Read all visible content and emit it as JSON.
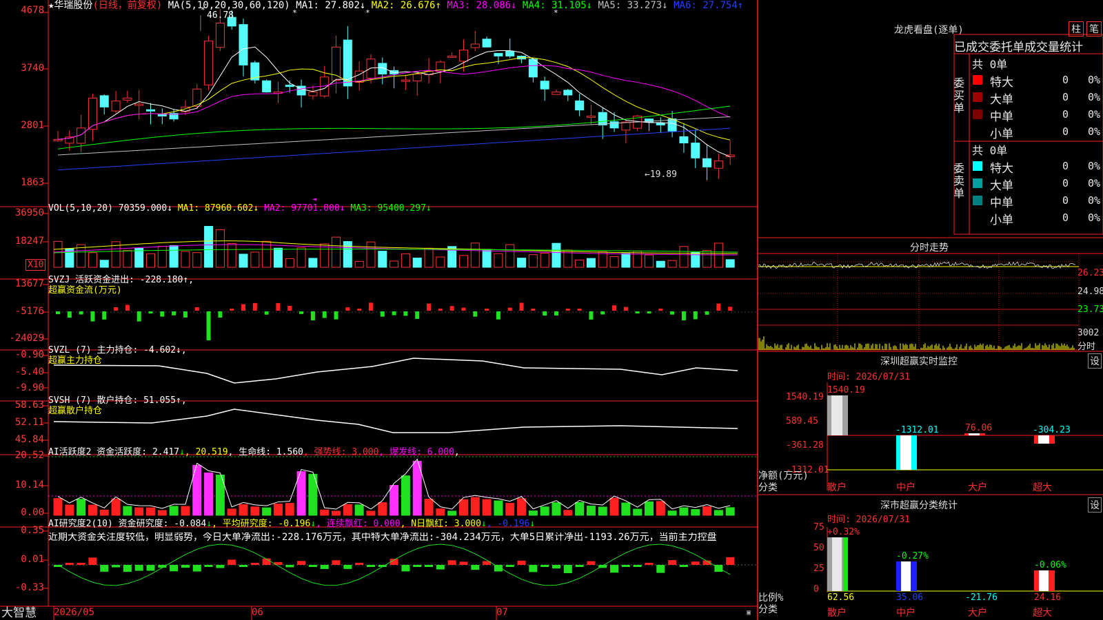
{
  "main": {
    "stock": "华瑞股份",
    "star": "★",
    "mode": "(日线，前复权)",
    "ma_label": "MA(5,10,20,30,60,120)",
    "ma_values": [
      {
        "text": "MA1: 27.802↓",
        "color": "#ffffff"
      },
      {
        "text": "MA2: 26.676↑",
        "color": "#ffff00"
      },
      {
        "text": "MA3: 28.086↓",
        "color": "#ff00ff"
      },
      {
        "text": "MA4: 31.105↓",
        "color": "#00ff00"
      },
      {
        "text": "MA5: 33.273↓",
        "color": "#c0c0c0"
      },
      {
        "text": "MA6: 27.754↑",
        "color": "#2040ff"
      }
    ],
    "yticks": [
      "4678",
      "3740",
      "2801",
      "1863"
    ],
    "high_label": "46.78",
    "low_label": "←19.89"
  },
  "vol": {
    "label": "VOL(5,10,20)",
    "values": [
      {
        "text": "70359.000↓",
        "color": "#ffffff"
      },
      {
        "text": "MA1: 87960.602↓",
        "color": "#ffff00"
      },
      {
        "text": "MA2: 97701.000↓",
        "color": "#ff00ff"
      },
      {
        "text": "MA3: 95400.297↓",
        "color": "#00ff00"
      }
    ],
    "yticks": [
      "36950",
      "18247"
    ],
    "unit": "X10"
  },
  "svzj": {
    "line1": "SVZJ  活跃资金进出: -228.180↑,",
    "line2": "超赢资金流(万元)",
    "yticks": [
      "13677",
      "-5176",
      "-24029"
    ]
  },
  "svzl": {
    "line1": "SVZL (7) 主力持仓: -4.602↓,",
    "line2": "超赢主力持仓",
    "yticks": [
      "-0.90",
      "-5.40",
      "-9.90"
    ]
  },
  "svsh": {
    "line1": "SVSH (7) 散户持仓: 51.055↑,",
    "line2": "超赢散户持仓",
    "yticks": [
      "58.63",
      "52.11",
      "45.84"
    ]
  },
  "ai1": {
    "parts": [
      {
        "text": "AI活跃度2 资金活跃度: 2.417",
        "color": "#ffffff"
      },
      {
        "text": "↓",
        "color": "#00ff00"
      },
      {
        "text": ", 20.519",
        "color": "#ffff00"
      },
      {
        "text": ", 生命线: 1.560",
        "color": "#ffffff"
      },
      {
        "text": ", 强势线: 3.000",
        "color": "#ff3030"
      },
      {
        "text": ", 爆发线: 6.000",
        "color": "#ff00ff"
      },
      {
        "text": ",",
        "color": "#ffffff"
      }
    ],
    "yticks": [
      "20.52",
      "10.14",
      "0.00"
    ]
  },
  "ai2": {
    "parts": [
      {
        "text": "AI研究度2(10) 资金研究度: -0.084",
        "color": "#ffffff"
      },
      {
        "text": "↓",
        "color": "#00ff00"
      },
      {
        "text": ", 平均研究度: -0.196",
        "color": "#ffff00"
      },
      {
        "text": "↓",
        "color": "#00ff00"
      },
      {
        "text": ", 连续飘红: 0.000",
        "color": "#ff00ff"
      },
      {
        "text": ", N日飘红: 3.000",
        "color": "#ffff00"
      },
      {
        "text": "↓",
        "color": "#00ff00"
      },
      {
        "text": ", -0.196",
        "color": "#2040ff"
      },
      {
        "text": "↓",
        "color": "#00ff00"
      }
    ],
    "note": "近期大资金关注度较低，明显弱势，今日大单净流出:-228.176万元，其中特大单净流出:-304.234万元，大单5日累计净出-1193.26万元，当前主力控盘",
    "yticks": [
      "0.35",
      "0.01",
      "-0.33"
    ]
  },
  "xaxis": {
    "brand": "大智慧",
    "labels": [
      "2026/05",
      "06",
      "07"
    ]
  },
  "right": {
    "title": "龙虎看盘(逐单)",
    "btn_zhu": "柱",
    "btn_bi": "笔",
    "header": "已成交委托单成交量统计",
    "buy_group": "委买单",
    "sell_group": "委卖单",
    "buy_total": "共 0单",
    "sell_total": "共 0单",
    "buy_rows": [
      {
        "name": "特大",
        "val": "0",
        "pct": "0%",
        "color": "#ff0000"
      },
      {
        "name": "大单",
        "val": "0",
        "pct": "0%",
        "color": "#a00000"
      },
      {
        "name": "中单",
        "val": "0",
        "pct": "0%",
        "color": "#800000"
      },
      {
        "name": "小单",
        "val": "0",
        "pct": "0%",
        "color": ""
      }
    ],
    "sell_rows": [
      {
        "name": "特大",
        "val": "0",
        "pct": "0%",
        "color": "#00ffff"
      },
      {
        "name": "大单",
        "val": "0",
        "pct": "0%",
        "color": "#00a0a0"
      },
      {
        "name": "中单",
        "val": "0",
        "pct": "0%",
        "color": "#008080"
      },
      {
        "name": "小单",
        "val": "0",
        "pct": "0%",
        "color": ""
      }
    ],
    "fenshi": {
      "title": "分时走势",
      "yticks": [
        "26.23",
        "24.98",
        "23.73"
      ],
      "vol_label": "3002",
      "unit": "分时"
    },
    "sz": {
      "title": "深圳超赢实时监控",
      "set": "设",
      "time": "时间: 2026/07/31",
      "yticks": [
        "1540.19",
        "589.45",
        "-361.28",
        "-1312.01"
      ],
      "bar_values": [
        "1540.19",
        "-1312.01",
        "76.06",
        "-304.23"
      ],
      "ylabel1": "净额(万元)",
      "ylabel2": "分类",
      "cats": [
        "散户",
        "中户",
        "大户",
        "超大"
      ]
    },
    "ss": {
      "title": "深市超赢分类统计",
      "set": "设",
      "time": "时间: 2026/07/31",
      "yticks": [
        "75",
        "50",
        "25",
        "0"
      ],
      "top_labels": [
        "+0.32%",
        "-0.27%",
        "",
        "-0.06%"
      ],
      "bottom_values": [
        "62.56",
        "35.06",
        "-21.76",
        "24.16"
      ],
      "ylabel1": "比例%",
      "ylabel2": "分类",
      "cats": [
        "散户",
        "中户",
        "大户",
        "超大"
      ]
    }
  }
}
